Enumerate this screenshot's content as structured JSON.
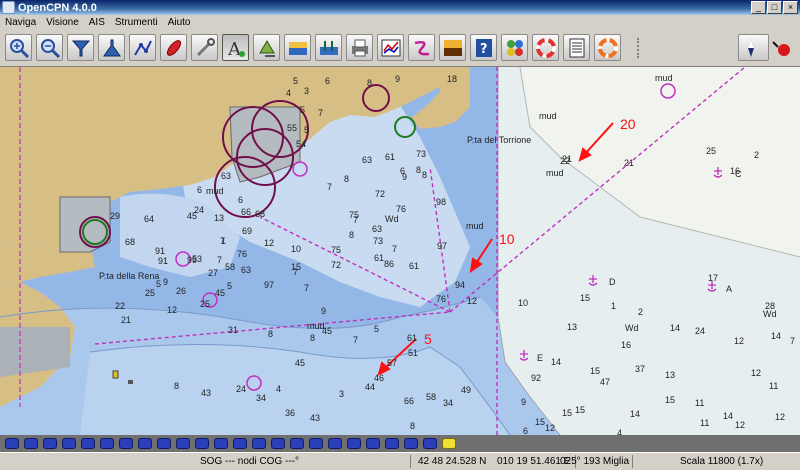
{
  "window": {
    "title": "OpenCPN 4.0.0",
    "controls": [
      "_",
      "□",
      "×"
    ]
  },
  "menu": {
    "items": [
      "Naviga",
      "Visione",
      "AIS",
      "Strumenti",
      "Aiuto"
    ]
  },
  "toolbar": {
    "buttons": [
      "zoom-in",
      "zoom-out",
      "scale-in",
      "scale-out",
      "route",
      "track",
      "settings",
      "text",
      "follow",
      "tide",
      "current",
      "print",
      "ais",
      "route-manager",
      "color-scheme",
      "help",
      "layers",
      "mob",
      "log",
      "lifebuoy"
    ],
    "active": "text"
  },
  "chart": {
    "depth_labels": [
      [
        "5",
        293,
        8
      ],
      [
        "6",
        325,
        8
      ],
      [
        "3",
        304,
        18
      ],
      [
        "4",
        286,
        20
      ],
      [
        "5",
        300,
        37
      ],
      [
        "7",
        318,
        40
      ],
      [
        "8",
        367,
        10
      ],
      [
        "9",
        395,
        6
      ],
      [
        "18",
        447,
        6
      ],
      [
        "mud",
        655,
        5
      ],
      [
        "55",
        287,
        55
      ],
      [
        "5",
        304,
        57
      ],
      [
        "54",
        296,
        71
      ],
      [
        "63",
        362,
        87
      ],
      [
        "61",
        385,
        84
      ],
      [
        "6",
        400,
        98
      ],
      [
        "73",
        416,
        81
      ],
      [
        "8",
        416,
        97
      ],
      [
        "9",
        402,
        104
      ],
      [
        "8",
        422,
        102
      ],
      [
        "mud",
        539,
        43
      ],
      [
        "P.ta del Torrione",
        467,
        67
      ],
      [
        "25",
        706,
        78
      ],
      [
        "2",
        754,
        82
      ],
      [
        "22",
        560,
        88
      ],
      [
        "21",
        624,
        90
      ],
      [
        "21",
        562,
        86
      ],
      [
        "mud",
        546,
        100
      ],
      [
        "16",
        730,
        98
      ],
      [
        "C",
        735,
        101
      ],
      [
        "mud",
        206,
        118
      ],
      [
        "63",
        221,
        103
      ],
      [
        "6",
        197,
        117
      ],
      [
        "6",
        238,
        127
      ],
      [
        "7",
        327,
        114
      ],
      [
        "8",
        344,
        106
      ],
      [
        "75",
        349,
        142
      ],
      [
        "72",
        375,
        121
      ],
      [
        "Wd",
        385,
        146
      ],
      [
        "76",
        396,
        136
      ],
      [
        "mud",
        466,
        153
      ],
      [
        "98",
        436,
        129
      ],
      [
        "66",
        241,
        139
      ],
      [
        "68",
        255,
        141
      ],
      [
        "69",
        242,
        158
      ],
      [
        "76",
        237,
        181
      ],
      [
        "63",
        241,
        197
      ],
      [
        "97",
        264,
        212
      ],
      [
        "7",
        217,
        187
      ],
      [
        "45",
        187,
        143
      ],
      [
        "64",
        144,
        146
      ],
      [
        "29",
        110,
        143
      ],
      [
        "68",
        125,
        169
      ],
      [
        "91",
        155,
        178
      ],
      [
        "91",
        158,
        188
      ],
      [
        "99",
        187,
        187
      ],
      [
        "13",
        214,
        145
      ],
      [
        "24",
        194,
        137
      ],
      [
        "12",
        264,
        170
      ],
      [
        "10",
        291,
        176
      ],
      [
        "15",
        291,
        194
      ],
      [
        "7",
        293,
        199
      ],
      [
        "72",
        331,
        192
      ],
      [
        "7",
        304,
        215
      ],
      [
        "75",
        331,
        177
      ],
      [
        "73",
        373,
        168
      ],
      [
        "63",
        372,
        156
      ],
      [
        "61",
        374,
        185
      ],
      [
        "86",
        384,
        191
      ],
      [
        "7",
        392,
        176
      ],
      [
        "61",
        409,
        193
      ],
      [
        "97",
        437,
        173
      ],
      [
        "7",
        353,
        147
      ],
      [
        "8",
        349,
        162
      ],
      [
        "53",
        192,
        186
      ],
      [
        "58",
        225,
        194
      ],
      [
        "1",
        221,
        168
      ],
      [
        "7",
        220,
        168
      ],
      [
        "P.ta della Rena",
        99,
        203
      ],
      [
        "5",
        156,
        211
      ],
      [
        "26",
        176,
        218
      ],
      [
        "45",
        215,
        220
      ],
      [
        "5",
        227,
        213
      ],
      [
        "25",
        200,
        231
      ],
      [
        "25",
        145,
        220
      ],
      [
        "27",
        208,
        200
      ],
      [
        "22",
        115,
        233
      ],
      [
        "21",
        121,
        247
      ],
      [
        "9",
        163,
        209
      ],
      [
        "mud",
        307,
        253
      ],
      [
        "31",
        228,
        257
      ],
      [
        "12",
        167,
        237
      ],
      [
        "9",
        321,
        238
      ],
      [
        "5",
        374,
        256
      ],
      [
        "61",
        407,
        265
      ],
      [
        "94",
        455,
        212
      ],
      [
        "76",
        436,
        226
      ],
      [
        "12",
        467,
        228
      ],
      [
        "10",
        518,
        230
      ],
      [
        "15",
        580,
        225
      ],
      [
        "1",
        611,
        233
      ],
      [
        "2",
        638,
        239
      ],
      [
        "17",
        708,
        205
      ],
      [
        "A",
        726,
        216
      ],
      [
        "Wd",
        763,
        241
      ],
      [
        "28",
        765,
        233
      ],
      [
        "D",
        609,
        209
      ],
      [
        "13",
        567,
        254
      ],
      [
        "16",
        621,
        272
      ],
      [
        "Wd",
        625,
        255
      ],
      [
        "14",
        670,
        255
      ],
      [
        "24",
        695,
        258
      ],
      [
        "12",
        734,
        268
      ],
      [
        "14",
        771,
        263
      ],
      [
        "7",
        790,
        268
      ],
      [
        "57",
        387,
        290
      ],
      [
        "46",
        374,
        305
      ],
      [
        "51",
        408,
        280
      ],
      [
        "92",
        531,
        305
      ],
      [
        "E",
        537,
        285
      ],
      [
        "14",
        551,
        289
      ],
      [
        "15",
        590,
        298
      ],
      [
        "37",
        635,
        296
      ],
      [
        "47",
        600,
        309
      ],
      [
        "13",
        665,
        302
      ],
      [
        "12",
        751,
        300
      ],
      [
        "11",
        769,
        313
      ],
      [
        "44",
        365,
        314
      ],
      [
        "45",
        295,
        290
      ],
      [
        "8",
        310,
        265
      ],
      [
        "7",
        353,
        267
      ],
      [
        "45",
        322,
        258
      ],
      [
        "8",
        268,
        261
      ],
      [
        "24",
        236,
        316
      ],
      [
        "34",
        256,
        325
      ],
      [
        "8",
        174,
        313
      ],
      [
        "43",
        201,
        320
      ],
      [
        "4",
        276,
        316
      ],
      [
        "66",
        404,
        328
      ],
      [
        "58",
        426,
        324
      ],
      [
        "49",
        461,
        317
      ],
      [
        "34",
        443,
        330
      ],
      [
        "9",
        521,
        329
      ],
      [
        "15",
        535,
        349
      ],
      [
        "15",
        562,
        340
      ],
      [
        "15",
        575,
        337
      ],
      [
        "4",
        617,
        360
      ],
      [
        "11",
        700,
        350
      ],
      [
        "12",
        735,
        352
      ],
      [
        "14",
        630,
        341
      ],
      [
        "15",
        665,
        327
      ],
      [
        "11",
        695,
        330
      ],
      [
        "14",
        723,
        343
      ],
      [
        "12",
        775,
        344
      ],
      [
        "36",
        285,
        340
      ],
      [
        "43",
        310,
        345
      ],
      [
        "3",
        339,
        321
      ],
      [
        "8",
        410,
        353
      ],
      [
        "6",
        523,
        358
      ],
      [
        "12",
        545,
        355
      ]
    ],
    "contour_labels": [
      [
        "20",
        620,
        48
      ],
      [
        "10",
        499,
        163
      ],
      [
        "5",
        424,
        263
      ]
    ],
    "coordinates": [
      "42 48 24.528 N",
      "010 19 51.461 E"
    ],
    "bearing": "025°",
    "distance": "193 Miglia"
  },
  "piano": {
    "count": 24,
    "selected": 23
  },
  "status": {
    "sog_cog": "SOG --- nodi COG ---°",
    "lat": "42 48 24.528 N",
    "lon": "010 19 51.461 E",
    "brg_dist": "025°  193 Miglia",
    "scale": "Scala 11800 (1.7x)"
  }
}
